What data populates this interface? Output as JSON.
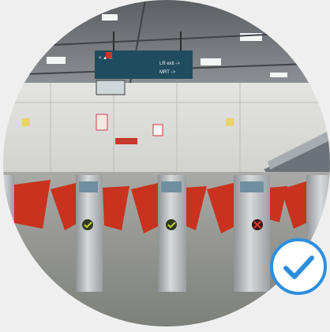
{
  "scene": {
    "signboard": {
      "left_glyph": "< ▲ ...",
      "right_line_1": "LR exit ->",
      "right_line_2": "MRT ->"
    }
  },
  "badge": {
    "icon": "checkmark-icon",
    "ring_color": "#2e8ede",
    "fill_color": "#ffffff"
  },
  "colors": {
    "page_bg": "#efefef",
    "flap_red": "#c8321e",
    "steel": "#b9bdc0",
    "floor": "#8c8e8a"
  }
}
